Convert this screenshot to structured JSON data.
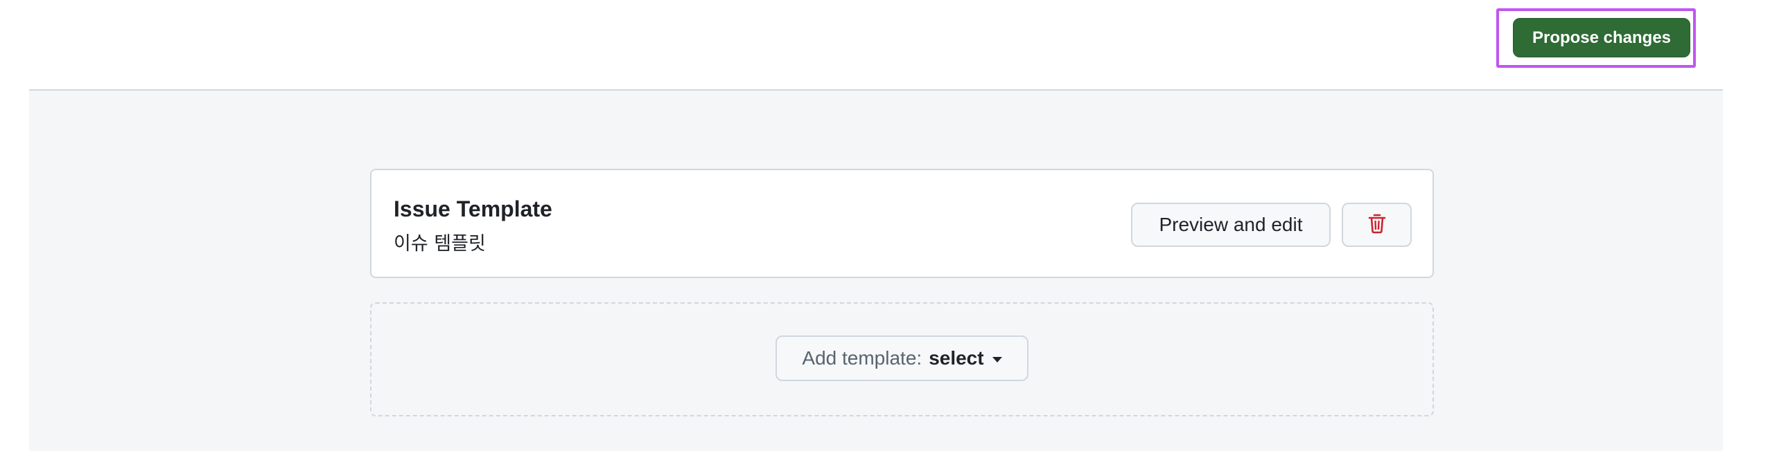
{
  "header": {
    "propose_label": "Propose changes"
  },
  "templates": [
    {
      "title": "Issue Template",
      "subtitle": "이슈 템플릿",
      "preview_label": "Preview and edit",
      "delete_icon": "trash-icon"
    }
  ],
  "add_template": {
    "label": "Add template:",
    "value": "select"
  },
  "colors": {
    "propose_button": "#2f6b35",
    "delete_icon": "#cf222e",
    "highlight": "#c155ef",
    "background": "#f5f6f8"
  }
}
